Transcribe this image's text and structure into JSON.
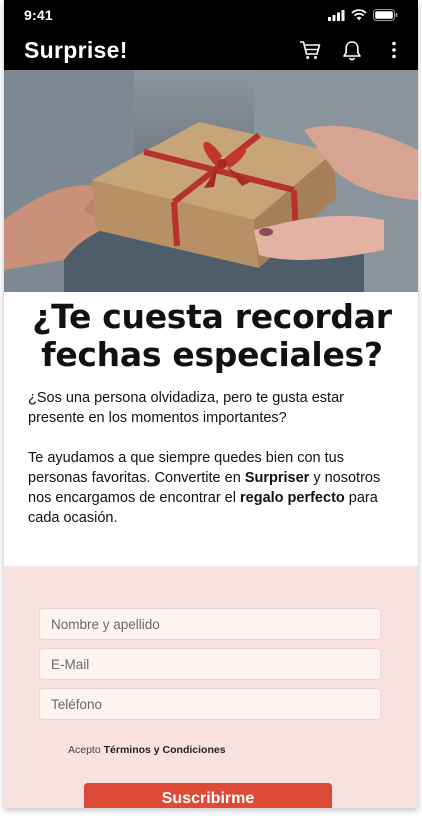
{
  "status_bar": {
    "time": "9:41"
  },
  "header": {
    "logo": "Surprise!",
    "icons": [
      "cart-icon",
      "bell-icon",
      "more-vertical-icon"
    ]
  },
  "hero": {
    "image": "hands-giving-gift-box-photo"
  },
  "main": {
    "headline": "¿Te cuesta recordar fechas especiales?",
    "paragraph1": "¿Sos una persona olvidadiza, pero te gusta estar presente en los momentos importantes?",
    "paragraph2": {
      "part1": "Te ayudamos a que siempre quedes bien con tus personas favoritas. Convertite en ",
      "bold1": "Surpriser",
      "part2": " y nosotros nos encargamos de encontrar el ",
      "bold2": "regalo perfecto",
      "part3": " para cada ocasión."
    }
  },
  "form": {
    "name_placeholder": "Nombre y apellido",
    "email_placeholder": "E-Mail",
    "phone_placeholder": "Teléfono",
    "terms_prefix": "Acepto ",
    "terms_link": "Términos y Condiciones",
    "submit_label": "Suscribirme"
  },
  "colors": {
    "topbar": "#000000",
    "form_background": "#f8e2df",
    "accent": "#dd4a36"
  }
}
